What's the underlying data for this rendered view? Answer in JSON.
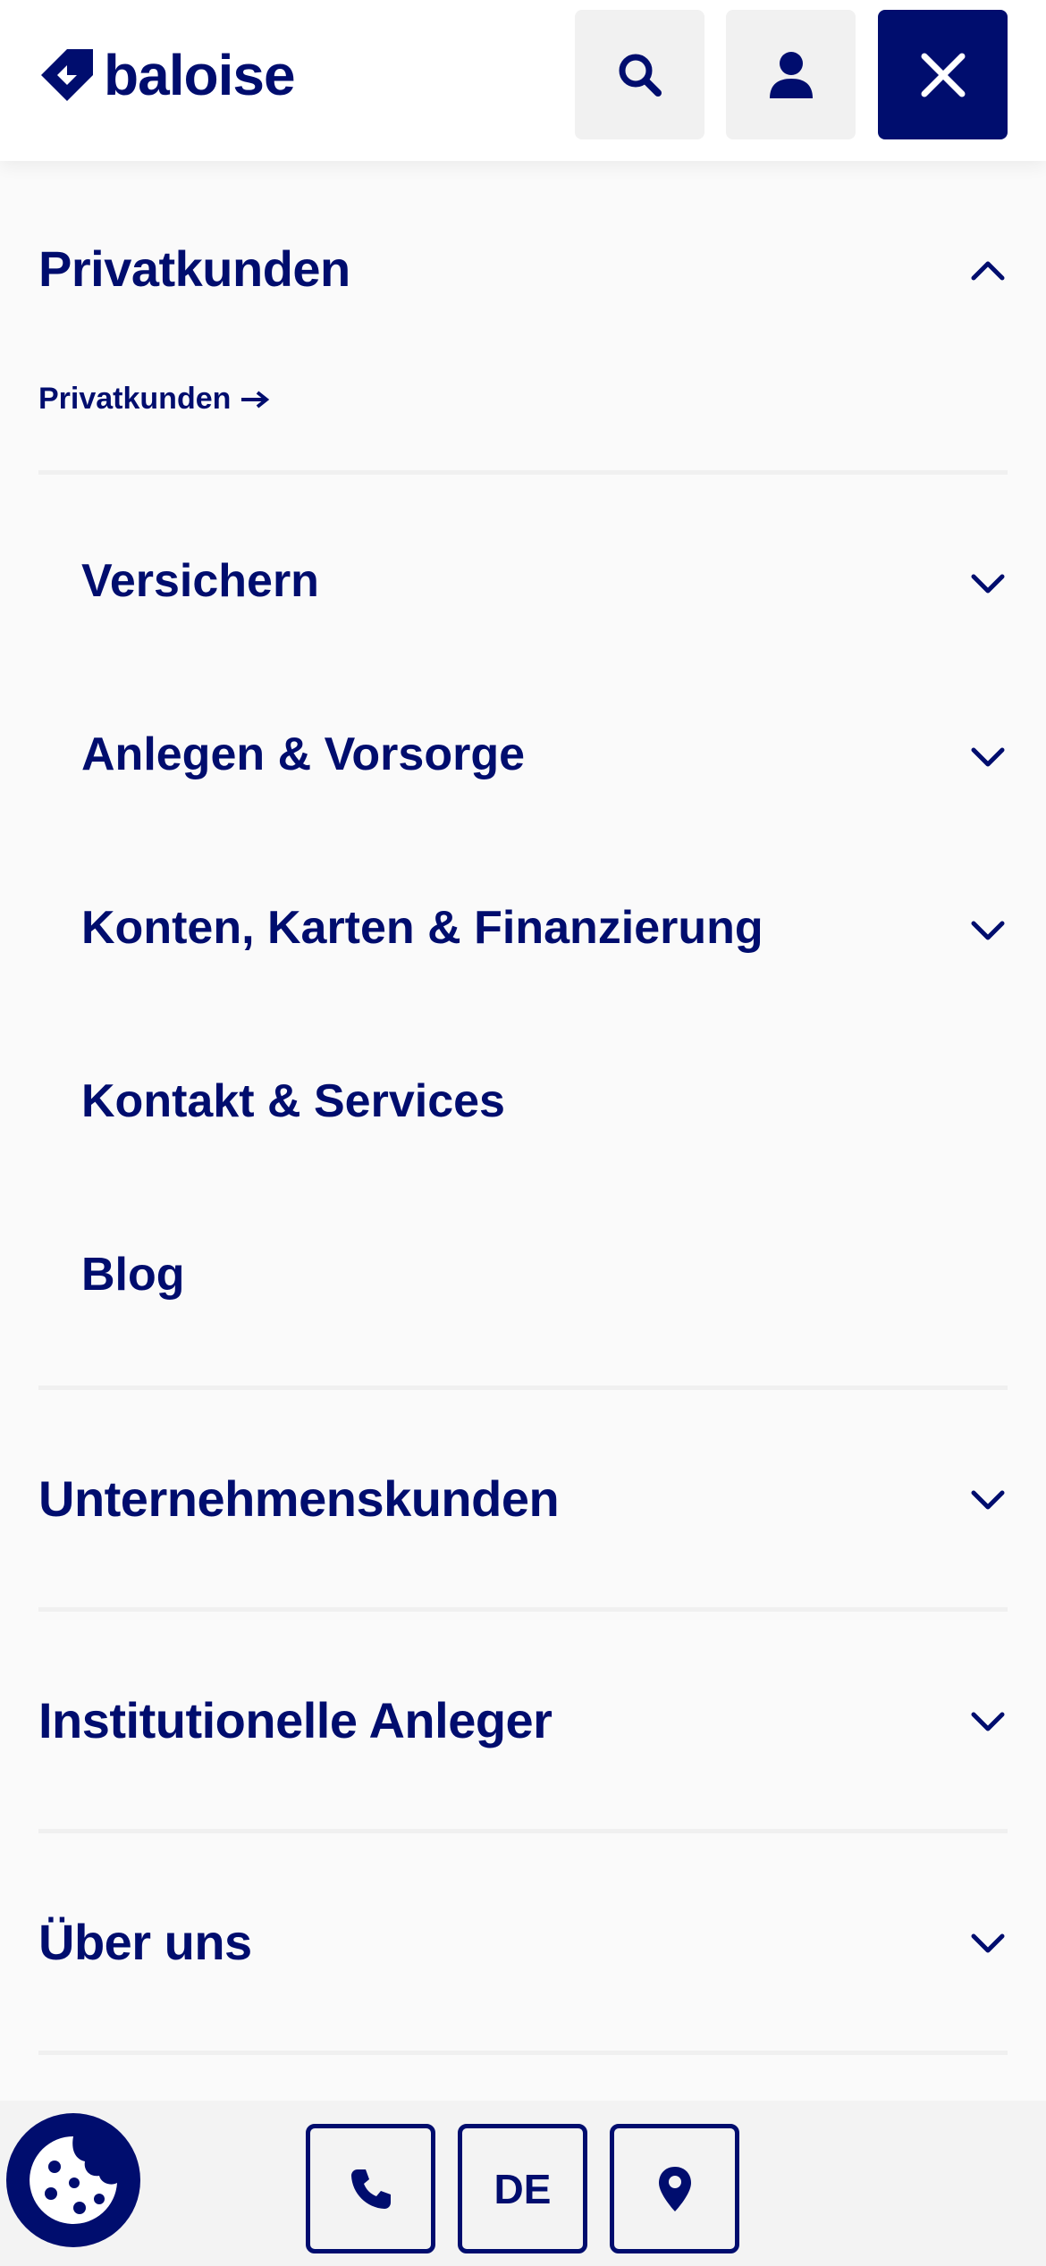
{
  "header": {
    "logo_text": "baloise",
    "search_icon": "search-icon",
    "user_icon": "user-icon",
    "close_icon": "close-icon"
  },
  "menu": {
    "sections": [
      {
        "label": "Privatkunden",
        "expanded": true,
        "overview_link": "Privatkunden",
        "subitems": [
          {
            "label": "Versichern",
            "has_children": true
          },
          {
            "label": "Anlegen & Vorsorge",
            "has_children": true
          },
          {
            "label": "Konten, Karten & Finanzierung",
            "has_children": true
          },
          {
            "label": "Kontakt & Services",
            "has_children": false
          },
          {
            "label": "Blog",
            "has_children": false
          }
        ]
      },
      {
        "label": "Unternehmenskunden",
        "expanded": false
      },
      {
        "label": "Institutionelle Anleger",
        "expanded": false
      },
      {
        "label": "Über uns",
        "expanded": false
      }
    ]
  },
  "footer": {
    "cookie_icon": "cookie-icon",
    "phone_icon": "phone-icon",
    "language": "DE",
    "location_icon": "location-pin-icon"
  },
  "colors": {
    "brand": "#000d6e",
    "header_bg": "#ffffff",
    "page_bg": "#fafafa",
    "button_grey": "#f1f1f1",
    "divider": "#f0f0f0",
    "footer_bg": "#f3f3f3"
  }
}
